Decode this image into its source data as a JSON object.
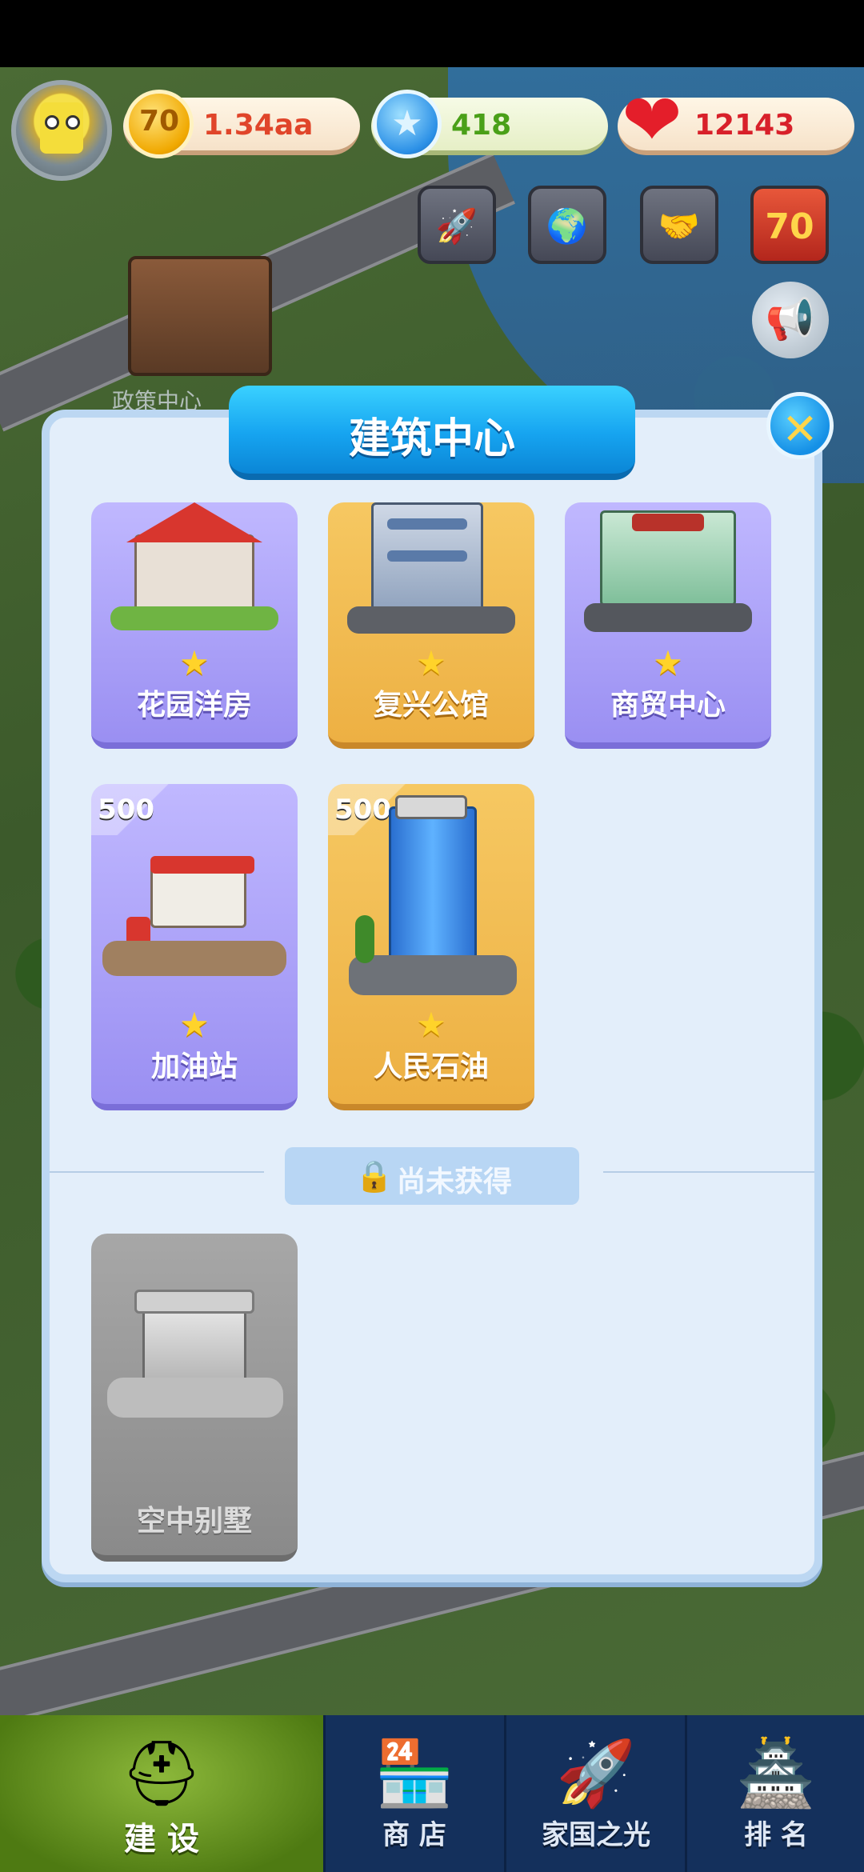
{
  "hud": {
    "coins": "1.34aa",
    "coin_symbol": "70",
    "gems": "418",
    "gem_symbol": "★",
    "hearts": "12143",
    "heart_symbol": "❤"
  },
  "map": {
    "label": "政策中心"
  },
  "panel": {
    "title": "建筑中心",
    "close_symbol": "✕",
    "owned": [
      {
        "name": "花园洋房",
        "style": "purple",
        "badge": ""
      },
      {
        "name": "复兴公馆",
        "style": "gold",
        "badge": ""
      },
      {
        "name": "商贸中心",
        "style": "purple",
        "badge": ""
      },
      {
        "name": "加油站",
        "style": "purple",
        "badge": "500"
      },
      {
        "name": "人民石油",
        "style": "gold",
        "badge": "500"
      }
    ],
    "locked_section_label": "尚未获得",
    "locked": [
      {
        "name": "空中别墅",
        "style": "gray"
      }
    ],
    "star_symbol": "★"
  },
  "nav": {
    "build": "建 设",
    "shop": "商 店",
    "home_light": "家国之光",
    "rank": "排 名"
  },
  "colors": {
    "panel_bg": "#e3eefa",
    "title_blue": "#16a4f0",
    "card_purple": "#9a8ff2",
    "card_gold": "#edb043",
    "nav_bg": "#14305c",
    "nav_active": "#6f9a26"
  }
}
